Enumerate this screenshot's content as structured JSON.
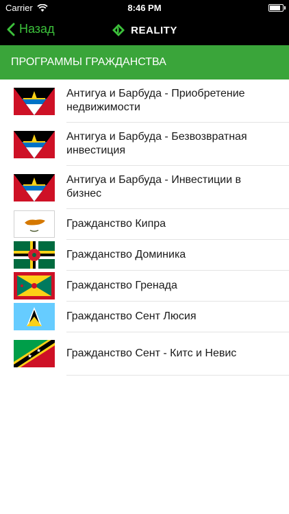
{
  "status": {
    "carrier": "Carrier",
    "time": "8:46 PM"
  },
  "nav": {
    "back_label": "Назад",
    "title": "REALITY"
  },
  "section_title": "ПРОГРАММЫ ГРАЖДАНСТВА",
  "items": [
    {
      "line1": "Антигуа и Барбуда - Приобретение",
      "line2": "недвижимости",
      "flag": "antigua-barbuda-flag"
    },
    {
      "line1": "Антигуа и Барбуда - Безвозвратная",
      "line2": "инвестиция",
      "flag": "antigua-barbuda-flag"
    },
    {
      "line1": "Антигуа и Барбуда - Инвестиции в",
      "line2": "бизнес",
      "flag": "antigua-barbuda-flag"
    },
    {
      "line1": "Гражданство Кипра",
      "line2": "",
      "flag": "cyprus-flag"
    },
    {
      "line1": "Гражданство Доминика",
      "line2": "",
      "flag": "dominica-flag"
    },
    {
      "line1": "Гражданство Гренада",
      "line2": "",
      "flag": "grenada-flag"
    },
    {
      "line1": "Гражданство Сент Люсия",
      "line2": "",
      "flag": "saint-lucia-flag"
    },
    {
      "line1": "Гражданство Сент - Китс и Невис",
      "line2": "",
      "flag": "saint-kitts-nevis-flag"
    }
  ],
  "colors": {
    "accent": "#3cc13b",
    "section_bg": "#3aa53a"
  }
}
